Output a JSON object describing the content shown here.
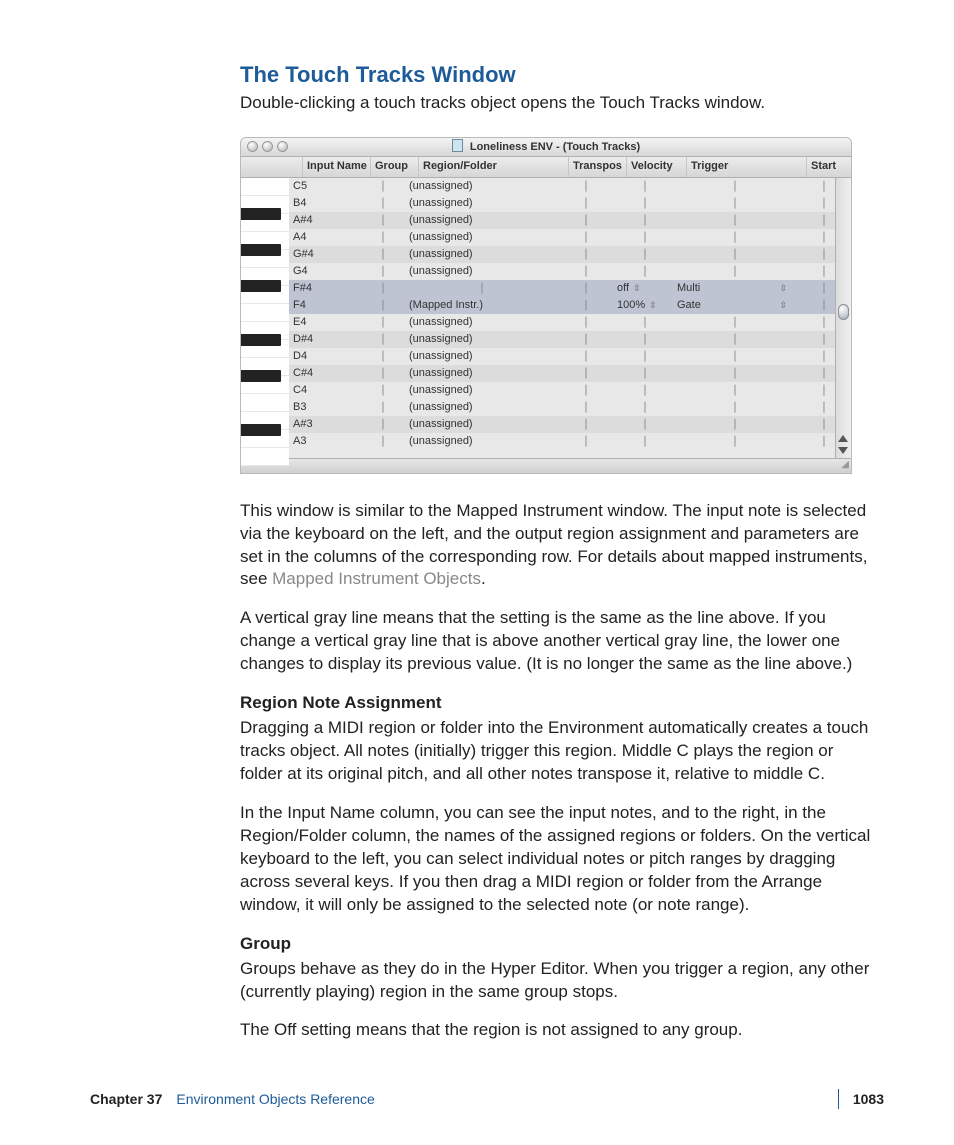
{
  "heading": "The Touch Tracks Window",
  "p_intro": "Double-clicking a touch tracks object opens the Touch Tracks window.",
  "shot": {
    "title": "Loneliness ENV -  (Touch Tracks)",
    "cols": [
      "",
      "Input Name",
      "Group",
      "Region/Folder",
      "Transpos",
      "Velocity",
      "Trigger",
      "Start"
    ],
    "rows": [
      {
        "n": "C5",
        "r": "(unassigned)",
        "black": false
      },
      {
        "n": "B4",
        "r": "(unassigned)",
        "black": false
      },
      {
        "n": "A#4",
        "r": "(unassigned)",
        "black": true
      },
      {
        "n": "A4",
        "r": "(unassigned)",
        "black": false
      },
      {
        "n": "G#4",
        "r": "(unassigned)",
        "black": true
      },
      {
        "n": "G4",
        "r": "(unassigned)",
        "black": false
      },
      {
        "n": "F#4",
        "r": "",
        "black": true,
        "vel": "off",
        "trg": "Multi",
        "spin": true,
        "sel": true
      },
      {
        "n": "F4",
        "r": "(Mapped Instr.)",
        "black": false,
        "vel": "100%",
        "trg": "Gate",
        "spin": true,
        "sel": true
      },
      {
        "n": "E4",
        "r": "(unassigned)",
        "black": false
      },
      {
        "n": "D#4",
        "r": "(unassigned)",
        "black": true
      },
      {
        "n": "D4",
        "r": "(unassigned)",
        "black": false
      },
      {
        "n": "C#4",
        "r": "(unassigned)",
        "black": true
      },
      {
        "n": "C4",
        "r": "(unassigned)",
        "black": false
      },
      {
        "n": "B3",
        "r": "(unassigned)",
        "black": false
      },
      {
        "n": "A#3",
        "r": "(unassigned)",
        "black": true
      },
      {
        "n": "A3",
        "r": "(unassigned)",
        "black": false
      }
    ]
  },
  "p_after1a": "This window is similar to the Mapped Instrument window. The input note is selected via the keyboard on the left, and the output region assignment and parameters are set in the columns of the corresponding row. For details about mapped instruments, see ",
  "link1": "Mapped Instrument Objects",
  "p_after1b": ".",
  "p_after2": "A vertical gray line means that the setting is the same as the line above. If you change a vertical gray line that is above another vertical gray line, the lower one changes to display its previous value. (It is no longer the same as the line above.)",
  "sub1": "Region Note Assignment",
  "p_sub1a": "Dragging a MIDI region or folder into the Environment automatically creates a touch tracks object. All notes (initially) trigger this region. Middle C plays the region or folder at its original pitch, and all other notes transpose it, relative to middle C.",
  "p_sub1b": "In the Input Name column, you can see the input notes, and to the right, in the Region/Folder column, the names of the assigned regions or folders. On the vertical keyboard to the left, you can select individual notes or pitch ranges by dragging across several keys. If you then drag a MIDI region or folder from the Arrange window, it will only be assigned to the selected note (or note range).",
  "sub2": "Group",
  "p_sub2a": "Groups behave as they do in the Hyper Editor. When you trigger a region, any other (currently playing) region in the same group stops.",
  "p_sub2b": "The Off setting means that the region is not assigned to any group.",
  "footer": {
    "chapter": "Chapter 37",
    "title": "Environment Objects Reference",
    "page": "1083"
  }
}
